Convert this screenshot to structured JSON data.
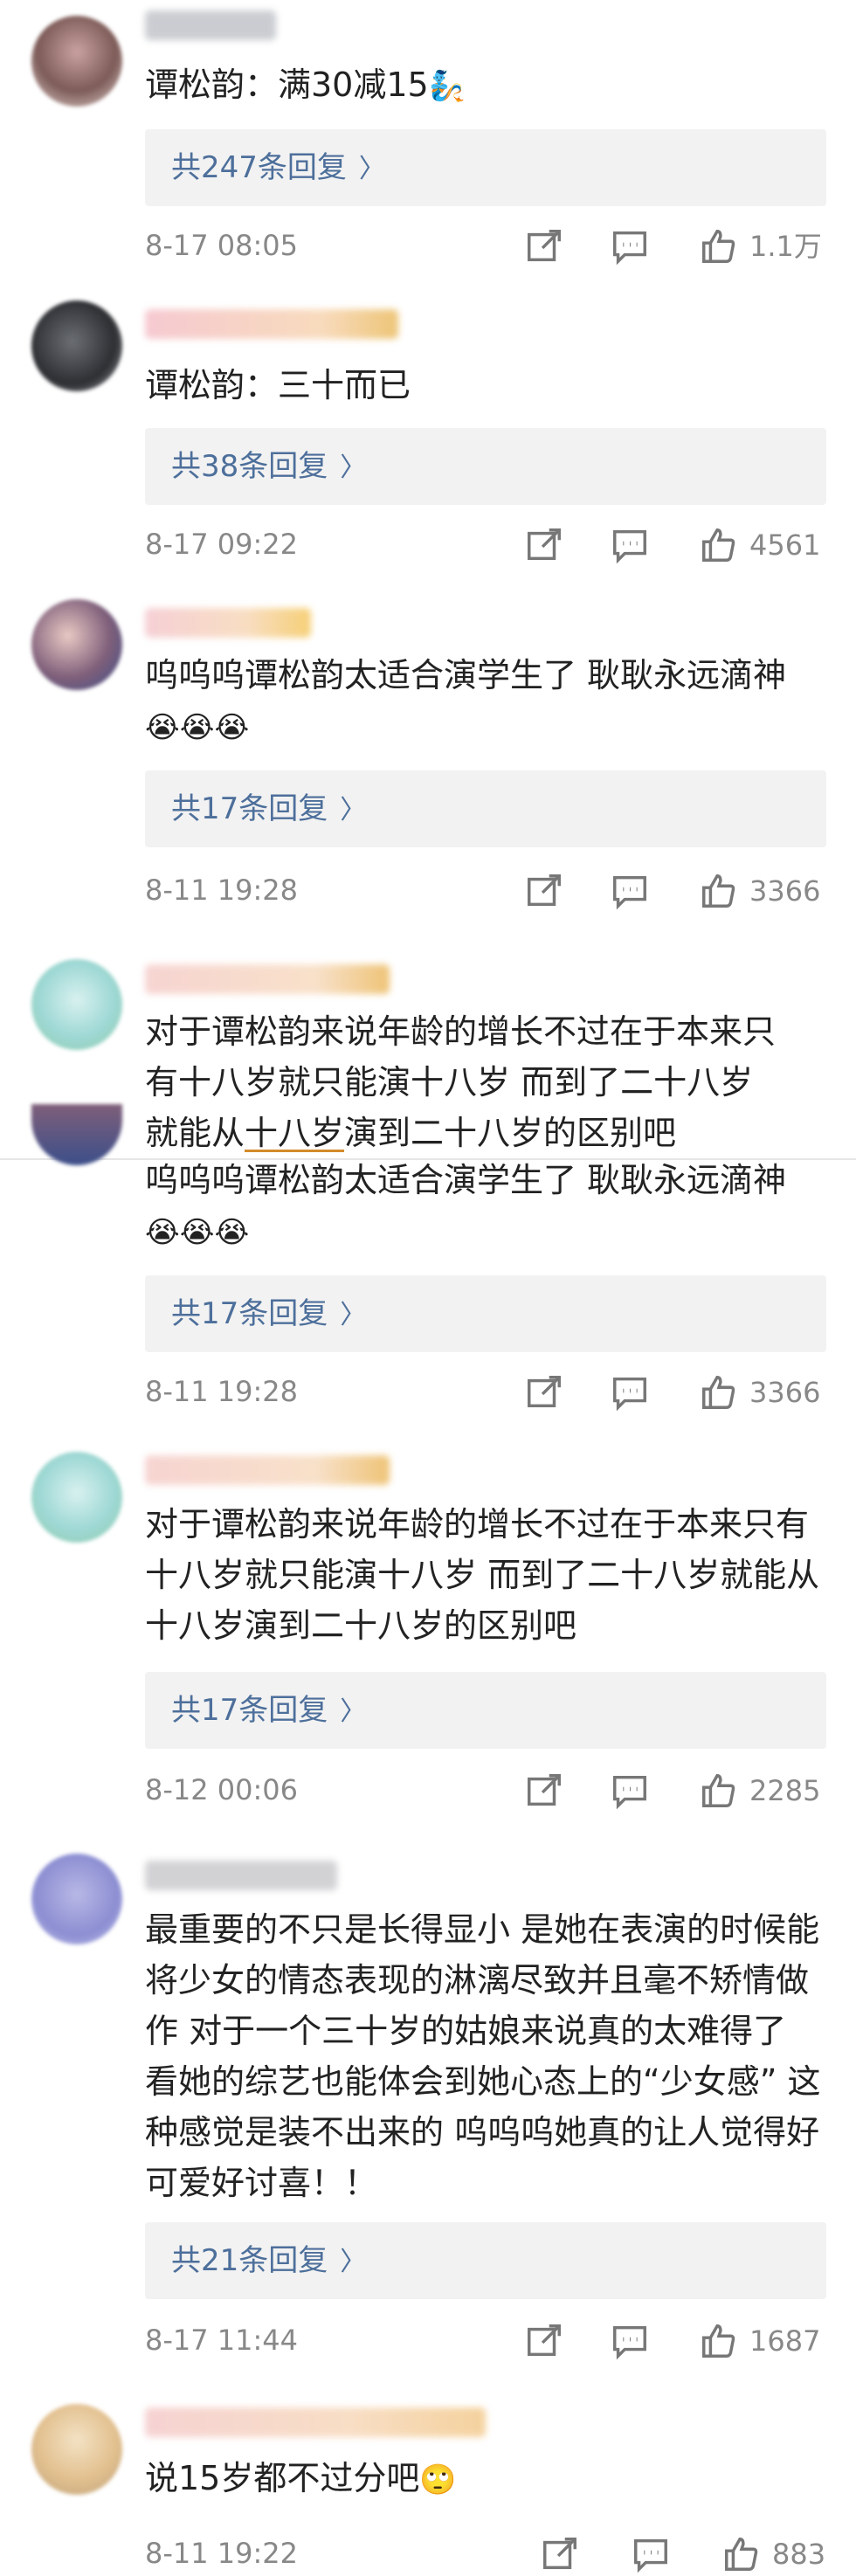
{
  "comments": [
    {
      "text": "谭松韵：满30减15",
      "emoji": "🧞",
      "replies_label": "共247条回复",
      "time": "8-17 08:05",
      "likes": "1.1万"
    },
    {
      "text": "谭松韵：三十而已",
      "replies_label": "共38条回复",
      "time": "8-17 09:22",
      "likes": "4561"
    },
    {
      "text": "呜呜呜谭松韵太适合演学生了 耿耿永远滴神",
      "emoji": "😭😭😭",
      "replies_label": "共17条回复",
      "time": "8-11 19:28",
      "likes": "3366"
    },
    {
      "line1": "对于谭松韵来说年龄的增长不过在于本来只",
      "line2": "有十八岁就只能演十八岁 而到了二十八岁",
      "line3a": "就能从",
      "line3b": "十八岁",
      "line3c": "演到二十八岁的区别吧"
    },
    {
      "text": "呜呜呜谭松韵太适合演学生了 耿耿永远滴神",
      "emoji": "😭😭😭",
      "replies_label": "共17条回复",
      "time": "8-11 19:28",
      "likes": "3366"
    },
    {
      "text": "对于谭松韵来说年龄的增长不过在于本来只有十八岁就只能演十八岁 而到了二十八岁就能从十八岁演到二十八岁的区别吧",
      "replies_label": "共17条回复",
      "time": "8-12 00:06",
      "likes": "2285"
    },
    {
      "text": "最重要的不只是长得显小 是她在表演的时候能将少女的情态表现的淋漓尽致并且毫不矫情做作 对于一个三十岁的姑娘来说真的太难得了 看她的综艺也能体会到她心态上的“少女感” 这种感觉是装不出来的 呜呜呜她真的让人觉得好可爱好讨喜！！",
      "replies_label": "共21条回复",
      "time": "8-17 11:44",
      "likes": "1687"
    },
    {
      "text": "说15岁都不过分吧",
      "emoji": "🙄",
      "time": "8-11 19:22",
      "likes": "883"
    }
  ],
  "chevron": "〉",
  "colors": {
    "link": "#4d6f9b",
    "meta": "#888888",
    "replies_bg": "#f2f2f2"
  }
}
